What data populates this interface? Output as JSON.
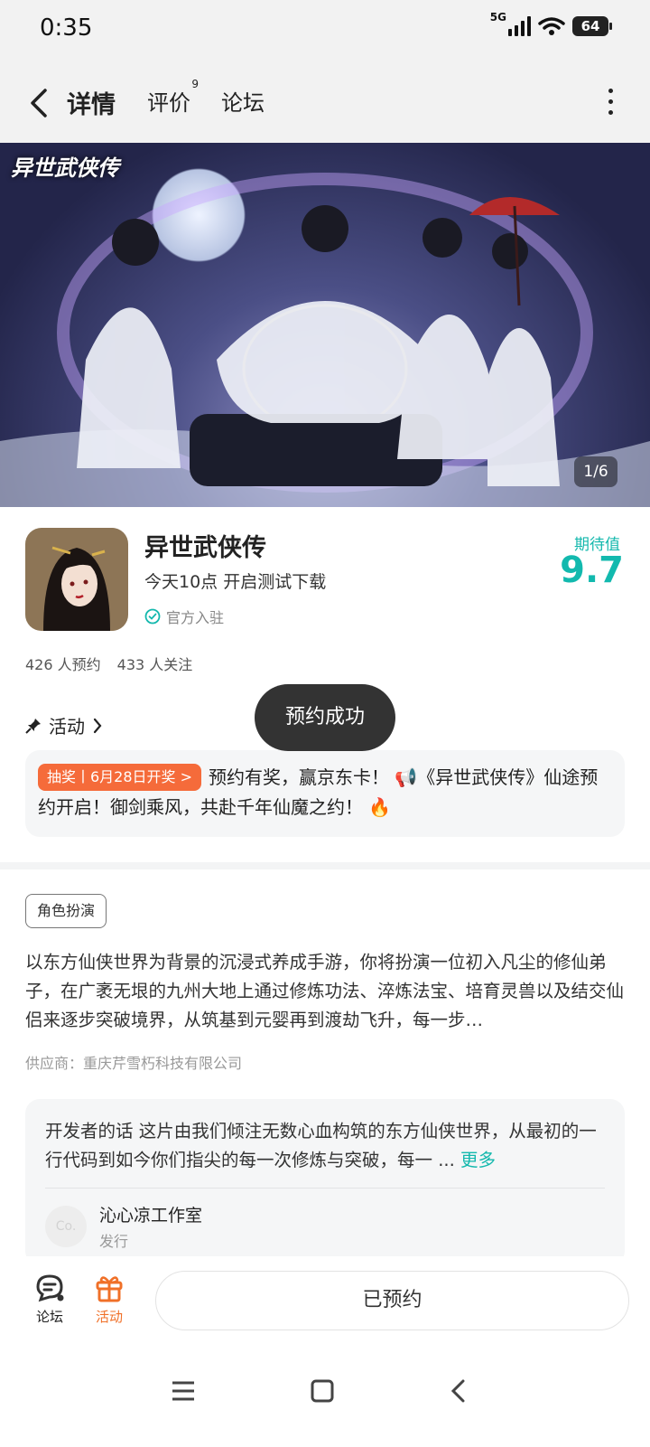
{
  "status_bar": {
    "time": "0:35",
    "network": "5G",
    "battery": "64"
  },
  "nav": {
    "tabs": [
      {
        "label": "详情",
        "active": true
      },
      {
        "label": "评价",
        "badge": "9"
      },
      {
        "label": "论坛"
      }
    ]
  },
  "banner": {
    "logo_text": "异世武侠传",
    "counter": "1/6"
  },
  "app": {
    "title": "异世武侠传",
    "subtitle": "今天10点 开启测试下载",
    "verified": "官方入驻",
    "expect_label": "期待值",
    "expect_score": "9.7",
    "reservations": "426 人预约",
    "followers": "433 人关注"
  },
  "activity": {
    "header": "活动",
    "toast": "预约成功",
    "tag": "抽奖丨6月28日开奖 >",
    "text": "预约有奖，赢京东卡！ 📢《异世武侠传》仙途预约开启！御剑乘风，共赴千年仙魔之约！ 🔥"
  },
  "genre": "角色扮演",
  "description": "以东方仙侠世界为背景的沉浸式养成手游，你将扮演一位初入凡尘的修仙弟子，在广袤无垠的九州大地上通过修炼功法、淬炼法宝、培育灵兽以及结交仙侣来逐步突破境界，从筑基到元婴再到渡劫飞升，每一步…",
  "supplier": "供应商：重庆芹雪朽科技有限公司",
  "developer": {
    "words": "开发者的话  这片由我们倾注无数心血构筑的东方仙侠世界，从最初的一行代码到如今你们指尖的每一次修炼与突破，每一 ... ",
    "more": "更多",
    "avatar_text": "Co.",
    "name": "沁心凉工作室",
    "role": "发行"
  },
  "bottom_bar": {
    "forum": "论坛",
    "activity": "活动",
    "action": "已预约"
  },
  "colors": {
    "accent": "#14c4b8",
    "score": "#12b9ae",
    "orange": "#f07028",
    "lottery": "#f56b3a"
  }
}
